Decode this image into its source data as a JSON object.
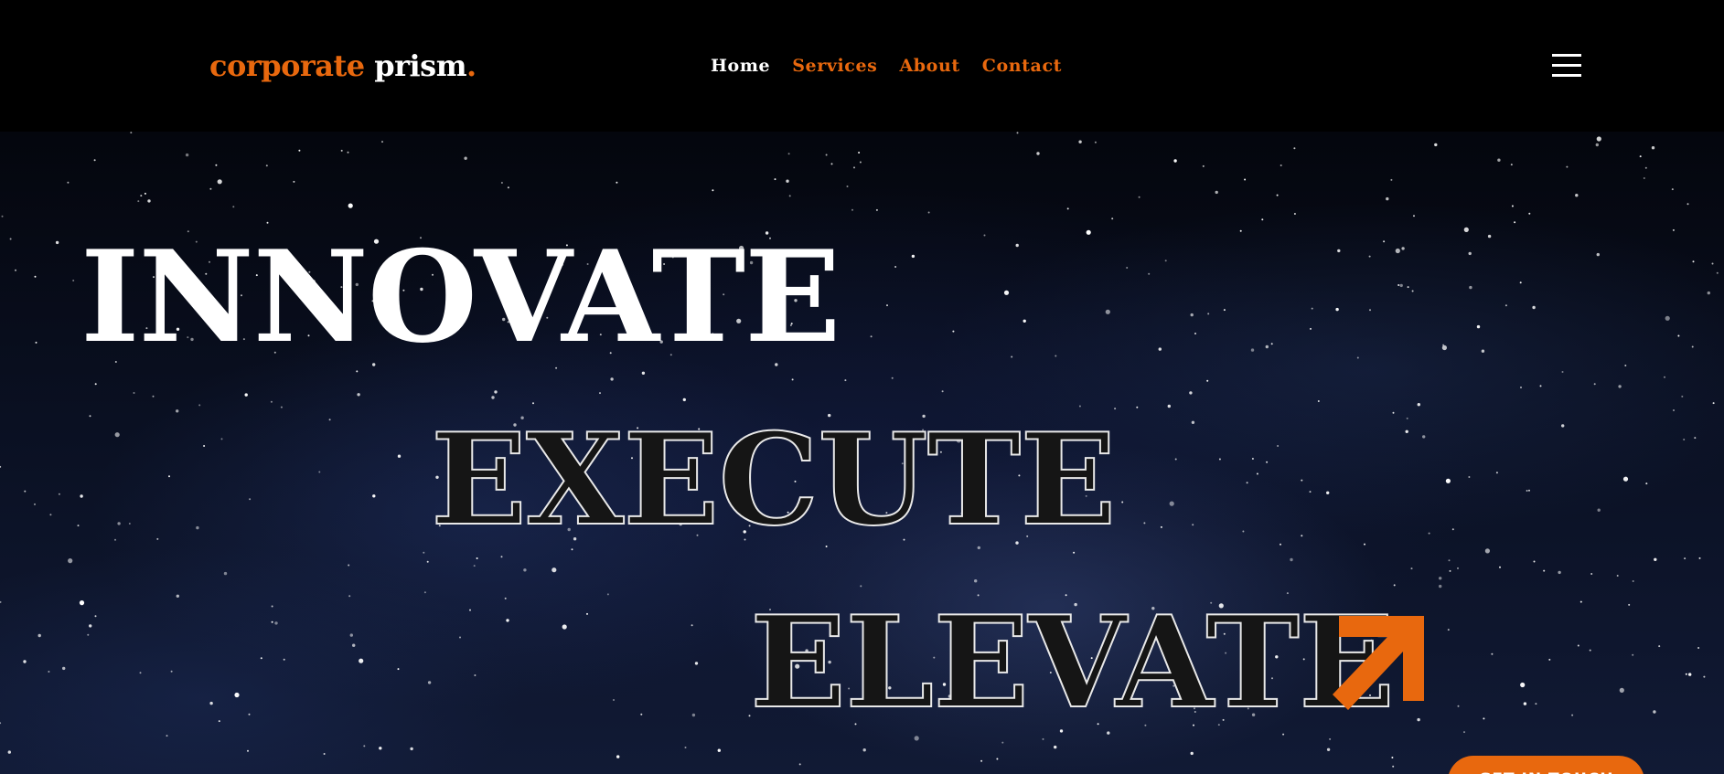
{
  "brand": {
    "part_1": "corporate",
    "part_2": "prism",
    "dot": ".",
    "accent_color": "#e8680e"
  },
  "nav": {
    "items": [
      {
        "label": "Home",
        "active": true
      },
      {
        "label": "Services",
        "active": false
      },
      {
        "label": "About",
        "active": false
      },
      {
        "label": "Contact",
        "active": false
      }
    ]
  },
  "menu": {
    "icon": "hamburger-menu-icon"
  },
  "hero": {
    "word_1": "INNOVATE",
    "word_2": "EXECUTE",
    "word_3": "ELEVATE",
    "arrow_icon": "arrow-up-right-icon",
    "cta_label": "GET IN TOUCH",
    "background": "starry-night-sky"
  }
}
